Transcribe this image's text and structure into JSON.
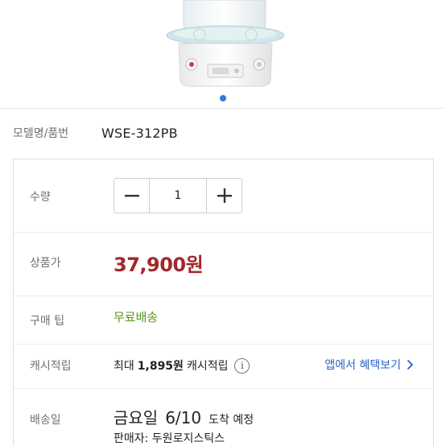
{
  "product": {
    "image_pager_active": 1,
    "model_label": "모델명/품번",
    "model_value": "WSE-312PB"
  },
  "options": {
    "quantity": {
      "label": "수량",
      "value": "1"
    },
    "price": {
      "label": "상품가",
      "value": "37,900원"
    },
    "tip": {
      "label": "구매 팁",
      "value": "무료배송"
    },
    "cash": {
      "label": "캐시적립",
      "prefix": "최대",
      "amount": "1,895원",
      "suffix": "캐시적립",
      "app_link": "앱에서 혜택보기"
    },
    "delivery": {
      "label": "배송일",
      "day": "금요일",
      "date": "6/10",
      "suffix": "도착 예정",
      "seller": "판매자: 두원로지스틱스"
    }
  },
  "colors": {
    "price": "#a3272b",
    "free_shipping": "#5a9a1a",
    "link": "#2a64c8",
    "pager": "#2b7bd6"
  }
}
